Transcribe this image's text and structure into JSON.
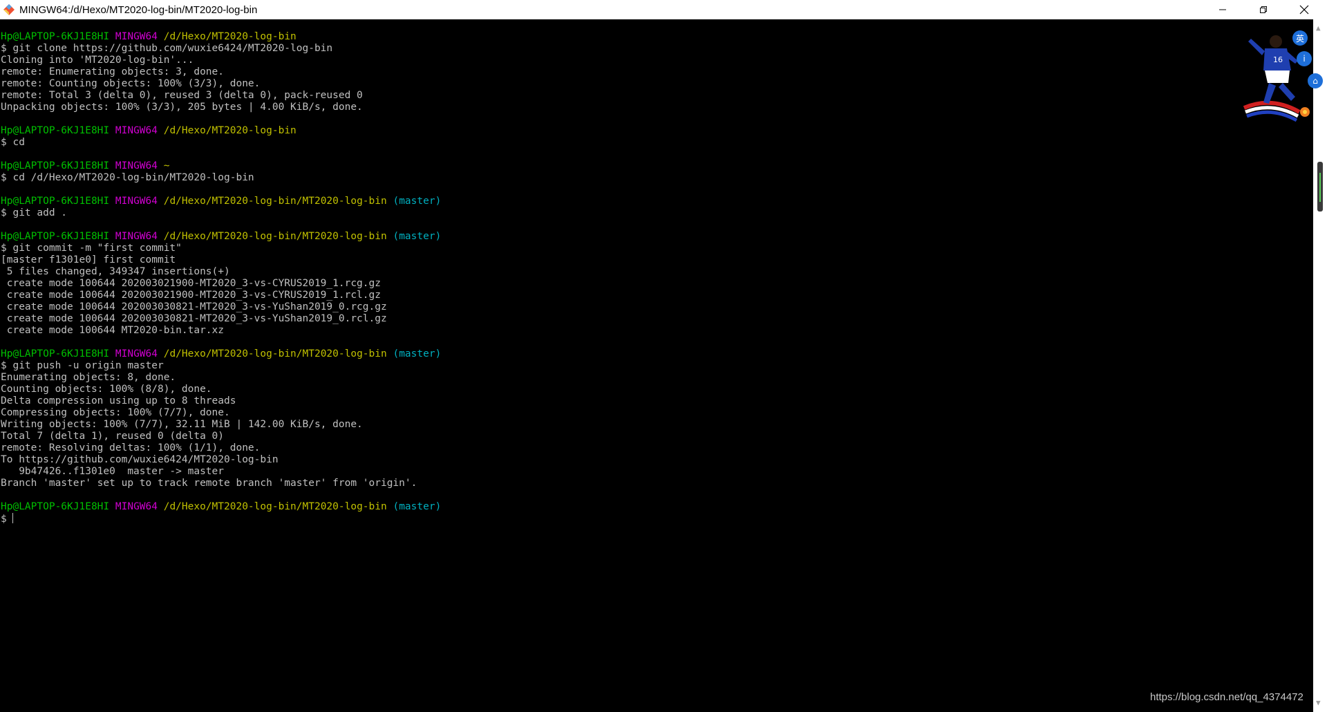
{
  "window": {
    "title": "MINGW64:/d/Hexo/MT2020-log-bin/MT2020-log-bin",
    "icon": "git-bash-icon",
    "controls": [
      "minimize-icon",
      "restore-icon",
      "close-icon"
    ]
  },
  "prompt": {
    "user": "Hp@LAPTOP-6KJ1E8HI",
    "system": "MINGW64"
  },
  "colors": {
    "user": "#00c000",
    "system": "#d000d0",
    "path": "#c0c000",
    "branch": "#00b0c0",
    "text": "#c0c0c0",
    "background": "#000000"
  },
  "terminal": {
    "lines": [
      {
        "type": "prompt",
        "user": "Hp@LAPTOP-6KJ1E8HI",
        "sys": "MINGW64",
        "path": "/d/Hexo/MT2020-log-bin",
        "branch": ""
      },
      {
        "type": "text",
        "text": "$ git clone https://github.com/wuxie6424/MT2020-log-bin"
      },
      {
        "type": "text",
        "text": "Cloning into 'MT2020-log-bin'..."
      },
      {
        "type": "text",
        "text": "remote: Enumerating objects: 3, done."
      },
      {
        "type": "text",
        "text": "remote: Counting objects: 100% (3/3), done."
      },
      {
        "type": "text",
        "text": "remote: Total 3 (delta 0), reused 3 (delta 0), pack-reused 0"
      },
      {
        "type": "text",
        "text": "Unpacking objects: 100% (3/3), 205 bytes | 4.00 KiB/s, done."
      },
      {
        "type": "text",
        "text": ""
      },
      {
        "type": "prompt",
        "user": "Hp@LAPTOP-6KJ1E8HI",
        "sys": "MINGW64",
        "path": "/d/Hexo/MT2020-log-bin",
        "branch": ""
      },
      {
        "type": "text",
        "text": "$ cd"
      },
      {
        "type": "text",
        "text": ""
      },
      {
        "type": "prompt",
        "user": "Hp@LAPTOP-6KJ1E8HI",
        "sys": "MINGW64",
        "path": "~",
        "branch": ""
      },
      {
        "type": "text",
        "text": "$ cd /d/Hexo/MT2020-log-bin/MT2020-log-bin"
      },
      {
        "type": "text",
        "text": ""
      },
      {
        "type": "prompt",
        "user": "Hp@LAPTOP-6KJ1E8HI",
        "sys": "MINGW64",
        "path": "/d/Hexo/MT2020-log-bin/MT2020-log-bin",
        "branch": "(master)"
      },
      {
        "type": "text",
        "text": "$ git add ."
      },
      {
        "type": "text",
        "text": ""
      },
      {
        "type": "prompt",
        "user": "Hp@LAPTOP-6KJ1E8HI",
        "sys": "MINGW64",
        "path": "/d/Hexo/MT2020-log-bin/MT2020-log-bin",
        "branch": "(master)"
      },
      {
        "type": "text",
        "text": "$ git commit -m \"first commit\""
      },
      {
        "type": "text",
        "text": "[master f1301e0] first commit"
      },
      {
        "type": "text",
        "text": " 5 files changed, 349347 insertions(+)"
      },
      {
        "type": "text",
        "text": " create mode 100644 202003021900-MT2020_3-vs-CYRUS2019_1.rcg.gz"
      },
      {
        "type": "text",
        "text": " create mode 100644 202003021900-MT2020_3-vs-CYRUS2019_1.rcl.gz"
      },
      {
        "type": "text",
        "text": " create mode 100644 202003030821-MT2020_3-vs-YuShan2019_0.rcg.gz"
      },
      {
        "type": "text",
        "text": " create mode 100644 202003030821-MT2020_3-vs-YuShan2019_0.rcl.gz"
      },
      {
        "type": "text",
        "text": " create mode 100644 MT2020-bin.tar.xz"
      },
      {
        "type": "text",
        "text": ""
      },
      {
        "type": "prompt",
        "user": "Hp@LAPTOP-6KJ1E8HI",
        "sys": "MINGW64",
        "path": "/d/Hexo/MT2020-log-bin/MT2020-log-bin",
        "branch": "(master)"
      },
      {
        "type": "text",
        "text": "$ git push -u origin master"
      },
      {
        "type": "text",
        "text": "Enumerating objects: 8, done."
      },
      {
        "type": "text",
        "text": "Counting objects: 100% (8/8), done."
      },
      {
        "type": "text",
        "text": "Delta compression using up to 8 threads"
      },
      {
        "type": "text",
        "text": "Compressing objects: 100% (7/7), done."
      },
      {
        "type": "text",
        "text": "Writing objects: 100% (7/7), 32.11 MiB | 142.00 KiB/s, done."
      },
      {
        "type": "text",
        "text": "Total 7 (delta 1), reused 0 (delta 0)"
      },
      {
        "type": "text",
        "text": "remote: Resolving deltas: 100% (1/1), done."
      },
      {
        "type": "text",
        "text": "To https://github.com/wuxie6424/MT2020-log-bin"
      },
      {
        "type": "text",
        "text": "   9b47426..f1301e0  master -> master"
      },
      {
        "type": "text",
        "text": "Branch 'master' set up to track remote branch 'master' from 'origin'."
      },
      {
        "type": "text",
        "text": ""
      },
      {
        "type": "prompt",
        "user": "Hp@LAPTOP-6KJ1E8HI",
        "sys": "MINGW64",
        "path": "/d/Hexo/MT2020-log-bin/MT2020-log-bin",
        "branch": "(master)"
      },
      {
        "type": "input",
        "text": "$ "
      }
    ]
  },
  "overlay": {
    "side_badge": "英",
    "watermark": "https://blog.csdn.net/qq_4374472"
  }
}
